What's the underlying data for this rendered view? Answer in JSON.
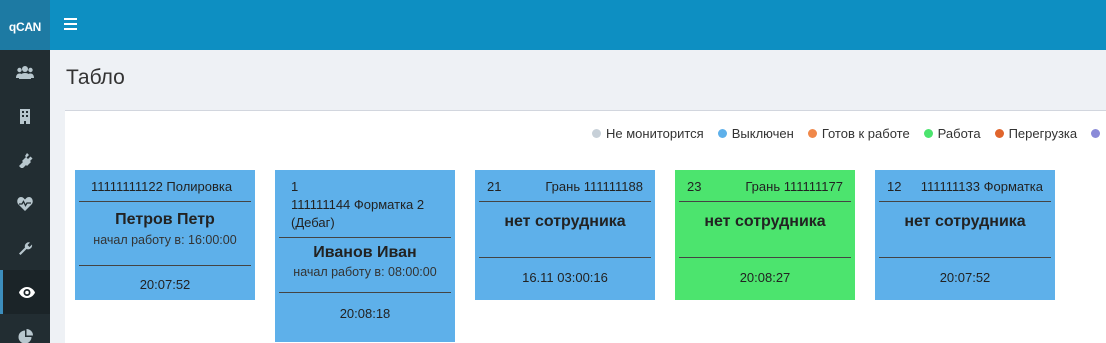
{
  "brand": "qCAN",
  "page_title": "Табло",
  "legend": [
    {
      "label": "Не мониторится",
      "color": "#c7d0d8"
    },
    {
      "label": "Выключен",
      "color": "#5eb0ea"
    },
    {
      "label": "Готов к работе",
      "color": "#f0884a"
    },
    {
      "label": "Работа",
      "color": "#4ce46e"
    },
    {
      "label": "Перегрузка",
      "color": "#e0652c"
    },
    {
      "label": "",
      "color": "#8a8ad8"
    }
  ],
  "sidebar": {
    "icons": [
      "users-icon",
      "building-icon",
      "plug-icon",
      "heartbeat-icon",
      "wrench-icon",
      "eye-icon",
      "pie-chart-icon"
    ]
  },
  "cards": [
    {
      "head": "11111111122 Полировка",
      "name": "Петров Петр",
      "since": "начал работу в: 16:00:00",
      "time": "20:07:52",
      "color": "#5eb0ea"
    },
    {
      "head_l1": "1",
      "head_l2": "111111144 Форматка 2",
      "head_l3": "(Дебаг)",
      "name": "Иванов Иван",
      "since": "начал работу в: 08:00:00",
      "time": "20:08:18",
      "color": "#5eb0ea"
    },
    {
      "head_left": "21",
      "head_right": "Грань 111111188",
      "name": "нет сотрудника",
      "time": "16.11 03:00:16",
      "color": "#5eb0ea"
    },
    {
      "head_left": "23",
      "head_right": "Грань 111111177",
      "name": "нет сотрудника",
      "time": "20:08:27",
      "color": "#4ce46e"
    },
    {
      "head_left": "12",
      "head_right": "111111133 Форматка",
      "name": "нет сотрудника",
      "time": "20:07:52",
      "color": "#5eb0ea"
    }
  ]
}
